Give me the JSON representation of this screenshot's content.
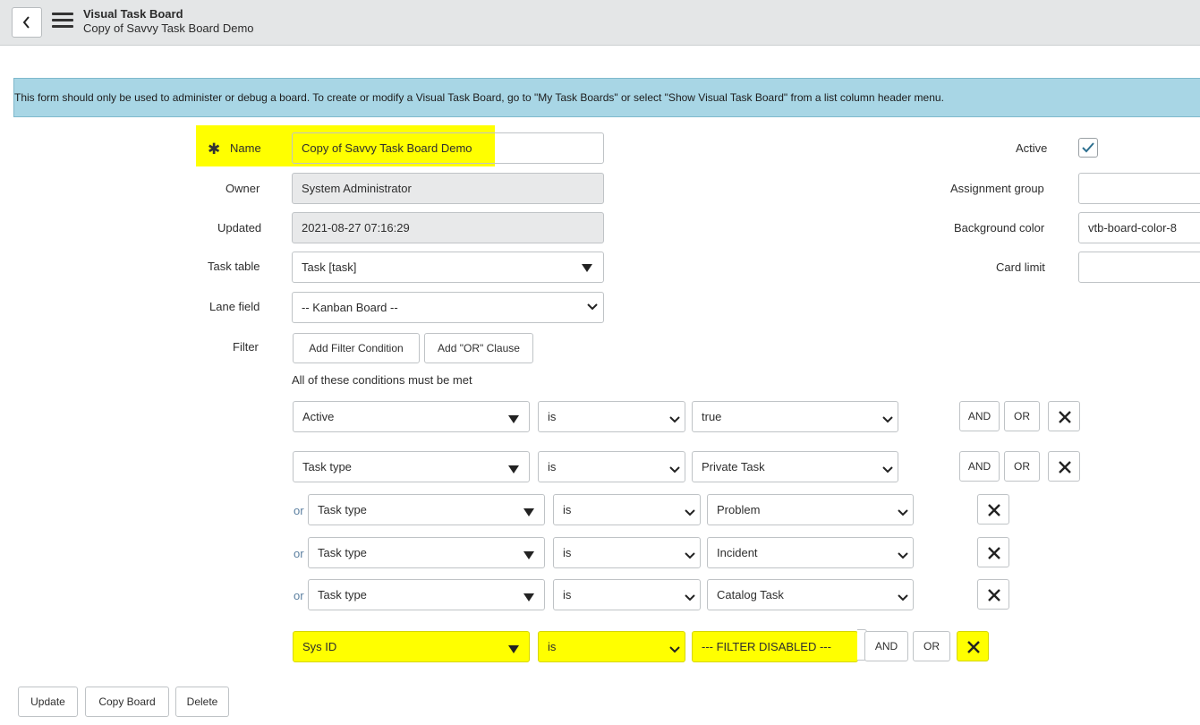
{
  "header": {
    "title": "Visual Task Board",
    "subtitle": "Copy of Savvy Task Board Demo",
    "back_icon": "chevron-left-icon",
    "menu_icon": "hamburger-icon"
  },
  "info_message": "This form should only be used to administer or debug a board. To create or modify a Visual Task Board, go to \"My Task Boards\" or select \"Show Visual Task Board\" from a list column header menu.",
  "form": {
    "required_mark": "✱",
    "name_label": "Name",
    "name_value": "Copy of Savvy Task Board Demo",
    "owner_label": "Owner",
    "owner_value": "System Administrator",
    "updated_label": "Updated",
    "updated_value": "2021-08-27 07:16:29",
    "task_table_label": "Task table",
    "task_table_value": "Task [task]",
    "lane_field_label": "Lane field",
    "lane_field_value": "-- Kanban Board --",
    "filter_label": "Filter",
    "active_label": "Active",
    "active_checked": true,
    "assignment_group_label": "Assignment group",
    "assignment_group_value": "",
    "background_color_label": "Background color",
    "background_color_value": "vtb-board-color-8",
    "card_limit_label": "Card limit",
    "card_limit_value": ""
  },
  "filter": {
    "add_condition_label": "Add Filter Condition",
    "add_or_label": "Add \"OR\" Clause",
    "conditions_caption": "All of these conditions must be met",
    "or_word": "or",
    "and_label": "AND",
    "or_label": "OR",
    "rows": [
      {
        "field": "Active",
        "operator": "is",
        "value": "true"
      },
      {
        "field": "Task type",
        "operator": "is",
        "value": "Private Task"
      },
      {
        "field": "Task type",
        "operator": "is",
        "value": "Problem"
      },
      {
        "field": "Task type",
        "operator": "is",
        "value": "Incident"
      },
      {
        "field": "Task type",
        "operator": "is",
        "value": "Catalog Task"
      },
      {
        "field": "Sys ID",
        "operator": "is",
        "value": "--- FILTER DISABLED ---"
      }
    ]
  },
  "actions": {
    "update": "Update",
    "copy_board": "Copy Board",
    "delete": "Delete"
  },
  "colors": {
    "highlight": "#ffff00",
    "info_bg": "#a8d6e5",
    "header_bg": "#e4e6e7"
  }
}
